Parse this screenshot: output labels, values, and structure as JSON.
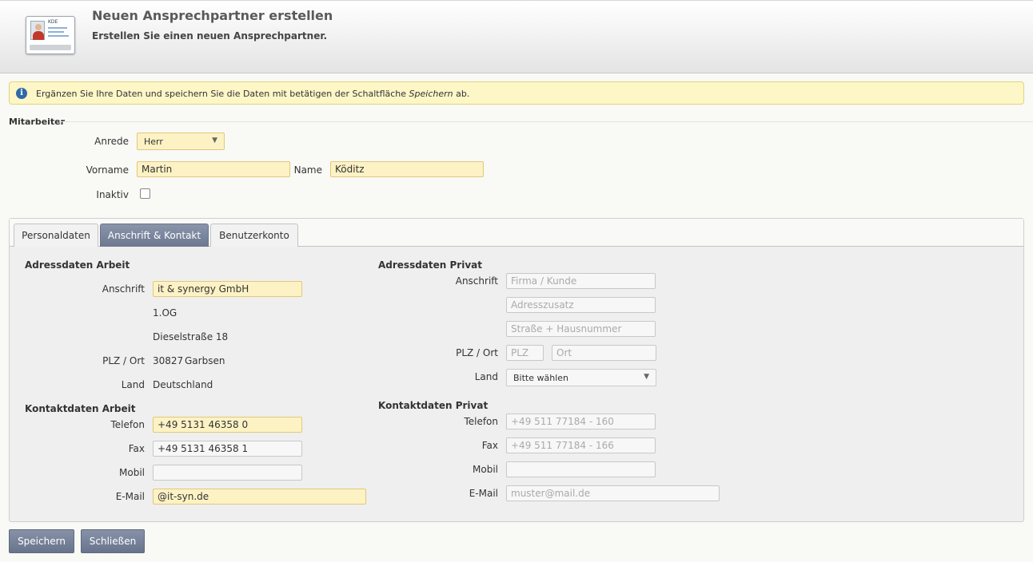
{
  "header": {
    "title": "Neuen Ansprechpartner erstellen",
    "subtitle": "Erstellen Sie einen neuen Ansprechpartner.",
    "icon_text": "KDE"
  },
  "info": {
    "text_before": "Ergänzen Sie Ihre Daten und speichern Sie die Daten mit betätigen der Schaltfläche ",
    "text_emph": "Speichern",
    "text_after": " ab."
  },
  "mitarbeiter": {
    "section_label": "Mitarbeiter",
    "anrede_label": "Anrede",
    "anrede_value": "Herr",
    "vorname_label": "Vorname",
    "vorname_value": "Martin",
    "name_label": "Name",
    "name_value": "Köditz",
    "inaktiv_label": "Inaktiv"
  },
  "tabs": [
    {
      "label": "Personaldaten"
    },
    {
      "label": "Anschrift & Kontakt"
    },
    {
      "label": "Benutzerkonto"
    }
  ],
  "arbeit": {
    "adress_title": "Adressdaten Arbeit",
    "anschrift_label": "Anschrift",
    "anschrift_value": "it & synergy GmbH",
    "zusatz": "1.OG",
    "strasse": "Dieselstraße 18",
    "plz_ort_label": "PLZ / Ort",
    "plz": "30827",
    "ort": "Garbsen",
    "land_label": "Land",
    "land": "Deutschland",
    "kontakt_title": "Kontaktdaten Arbeit",
    "telefon_label": "Telefon",
    "telefon_value": "+49 5131 46358 0",
    "fax_label": "Fax",
    "fax_value": "+49 5131 46358 1",
    "mobil_label": "Mobil",
    "mobil_value": "",
    "email_label": "E-Mail",
    "email_value": "@it-syn.de"
  },
  "privat": {
    "adress_title": "Adressdaten Privat",
    "anschrift_label": "Anschrift",
    "firma_placeholder": "Firma / Kunde",
    "zusatz_placeholder": "Adresszusatz",
    "strasse_placeholder": "Straße + Hausnummer",
    "plz_ort_label": "PLZ / Ort",
    "plz_placeholder": "PLZ",
    "ort_placeholder": "Ort",
    "land_label": "Land",
    "land_value": "Bitte wählen",
    "kontakt_title": "Kontaktdaten Privat",
    "telefon_label": "Telefon",
    "telefon_placeholder": "+49 511 77184 - 160",
    "fax_label": "Fax",
    "fax_placeholder": "+49 511 77184 - 166",
    "mobil_label": "Mobil",
    "email_label": "E-Mail",
    "email_placeholder": "muster@mail.de"
  },
  "buttons": {
    "save": "Speichern",
    "close": "Schließen"
  },
  "colors": {
    "required_field": "#fdf2c4",
    "active_tab": "#7a859d",
    "info_bar": "#fdf6c6"
  }
}
